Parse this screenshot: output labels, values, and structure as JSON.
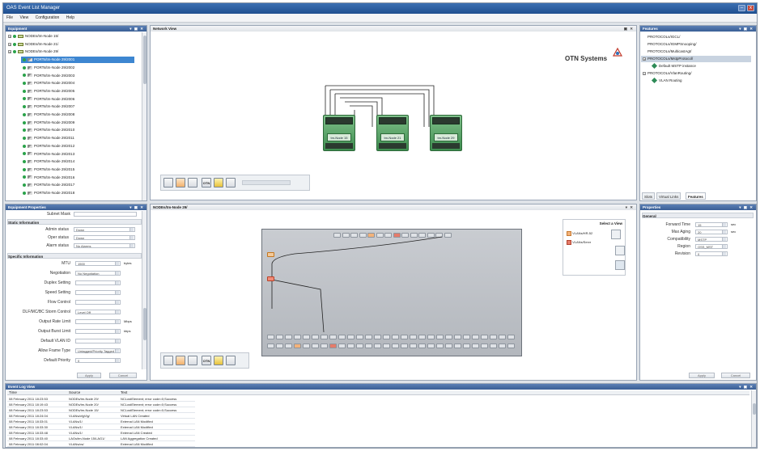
{
  "window": {
    "title": "OAS Event List Manager",
    "minimize_glyph": "–",
    "restore_glyph": "❐",
    "close_glyph": "x"
  },
  "menu": [
    "File",
    "View",
    "Configuration",
    "Help"
  ],
  "equipment": {
    "title": "Equipment",
    "controls": "▾ ▣ ✕",
    "nodes": [
      {
        "label": "NODEs/tm-Node 15/",
        "kind": "node",
        "indent": 0
      },
      {
        "label": "NODEs/tm-Node 21/",
        "kind": "node",
        "indent": 0
      },
      {
        "label": "NODEs/tm-Node 29/",
        "kind": "node",
        "indent": 0
      },
      {
        "label": "PORTs/tm-Node 29/2001",
        "kind": "port",
        "indent": 1,
        "selected": true
      },
      {
        "label": "PORTs/tm-Node 29/2002",
        "kind": "port",
        "indent": 1
      },
      {
        "label": "PORTs/tm-Node 29/2003",
        "kind": "port",
        "indent": 1
      },
      {
        "label": "PORTs/tm-Node 29/2004",
        "kind": "port",
        "indent": 1
      },
      {
        "label": "PORTs/tm-Node 29/2005",
        "kind": "port",
        "indent": 1
      },
      {
        "label": "PORTs/tm-Node 29/2006",
        "kind": "port",
        "indent": 1
      },
      {
        "label": "PORTs/tm-Node 29/2007",
        "kind": "port",
        "indent": 1
      },
      {
        "label": "PORTs/tm-Node 29/2008",
        "kind": "port",
        "indent": 1
      },
      {
        "label": "PORTs/tm-Node 29/2009",
        "kind": "port",
        "indent": 1
      },
      {
        "label": "PORTs/tm-Node 29/2010",
        "kind": "port",
        "indent": 1
      },
      {
        "label": "PORTs/tm-Node 29/2011",
        "kind": "port",
        "indent": 1
      },
      {
        "label": "PORTs/tm-Node 29/2012",
        "kind": "port",
        "indent": 1
      },
      {
        "label": "PORTs/tm-Node 29/2013",
        "kind": "port",
        "indent": 1
      },
      {
        "label": "PORTs/tm-Node 29/2014",
        "kind": "port",
        "indent": 1
      },
      {
        "label": "PORTs/tm-Node 29/2015",
        "kind": "port",
        "indent": 1
      },
      {
        "label": "PORTs/tm-Node 29/2016",
        "kind": "port",
        "indent": 1
      },
      {
        "label": "PORTs/tm-Node 29/2017",
        "kind": "port",
        "indent": 1
      },
      {
        "label": "PORTs/tm-Node 29/2018",
        "kind": "port",
        "indent": 1
      }
    ]
  },
  "network_view": {
    "title": "Network View",
    "controls": "▣ ✕",
    "logo_text": "OTN Systems",
    "devices": [
      "tm-Node 15",
      "tm-Node 21",
      "tm-Node 29"
    ],
    "toolbar_icons": [
      "print-icon",
      "export-icon",
      "image-icon",
      "otn-icon",
      "lock-icon",
      "zoom-icon"
    ],
    "toolbar_otn_label": "OTN"
  },
  "node_view": {
    "title": "NODEs/tm-Node 29/",
    "controls": "▾ ✕",
    "select_title": "Select a View",
    "views": [
      "VLANs/HR-52",
      "VLANs/Servr"
    ],
    "toolbar_otn_label": "OTN"
  },
  "features": {
    "title": "Features",
    "controls": "▾ ▣ ✕",
    "items": [
      {
        "label": "PROTOCOLs/IGCL/",
        "indent": 1
      },
      {
        "label": "PROTOCOLs/IGMPSnooping/",
        "indent": 1
      },
      {
        "label": "PROTOCOLs/MulticastAgt/",
        "indent": 1
      },
      {
        "label": "PROTOCOLs/MstpProtocol/",
        "indent": 0,
        "selected": true,
        "expander": "+"
      },
      {
        "label": "Default MSTP instance",
        "indent": 2,
        "icon": true
      },
      {
        "label": "PROTOCOLs/VlanRouting/",
        "indent": 0,
        "expander": "−"
      },
      {
        "label": "VLAN Routing",
        "indent": 2,
        "icon": true
      }
    ],
    "tabs": [
      "Slots",
      "Virtual Links",
      "Features"
    ],
    "active_tab": "Features"
  },
  "eq_props": {
    "title": "Equipment Properties",
    "controls": "▾ ▣ ✕",
    "subnet_label": "Subnet Mask",
    "status_section": "Static Information",
    "status_rows": [
      {
        "label": "Admin status",
        "value": "Down"
      },
      {
        "label": "Oper status",
        "value": "Down"
      },
      {
        "label": "Alarm status",
        "value": "No Alarms"
      }
    ],
    "specific_section": "Specific Information",
    "specific_rows": [
      {
        "label": "MTU",
        "value": "1500",
        "unit": "bytes"
      },
      {
        "label": "Negotiation",
        "value": "No Negotiation"
      },
      {
        "label": "Duplex Setting",
        "value": ""
      },
      {
        "label": "Speed Setting",
        "value": ""
      },
      {
        "label": "Flow Control",
        "value": ""
      },
      {
        "label": "DLF/MC/BC Storm Control",
        "value": "Level Off"
      },
      {
        "label": "Output Rate Limit",
        "value": "",
        "unit": "Mbps"
      },
      {
        "label": "Output Burst Limit",
        "value": "",
        "unit": "kbps"
      },
      {
        "label": "Default VLAN ID",
        "value": ""
      },
      {
        "label": "Allow Frame Type",
        "value": "Untagged/Priority Tagged"
      },
      {
        "label": "Default Priority",
        "value": "0"
      }
    ],
    "apply_label": "Apply",
    "cancel_label": "Cancel"
  },
  "properties": {
    "title": "Properties",
    "controls": "▾ ▣ ✕",
    "section": "General",
    "rows": [
      {
        "label": "Forward Time",
        "value": "15",
        "unit": "sec"
      },
      {
        "label": "Max Aging",
        "value": "20",
        "unit": "sec"
      },
      {
        "label": "Compatibility",
        "value": "MSTP"
      },
      {
        "label": "Region",
        "value": "OSS_MST"
      },
      {
        "label": "Revision",
        "value": "0"
      }
    ],
    "apply_label": "Apply",
    "cancel_label": "Cancel"
  },
  "event_log": {
    "title": "Event Log View",
    "controls": "▾ ▣ ✕",
    "columns": [
      "Time",
      "Source",
      "Text"
    ],
    "rows": [
      {
        "time": "08 February 2011 18:23:53",
        "source": "NODEs/tm-Node 29/",
        "text": "NCLostElement; error code=0;Success"
      },
      {
        "time": "08 February 2011 18:19:43",
        "source": "NODEs/tm-Node 20/",
        "text": "NCLostElement; error code=0;Success"
      },
      {
        "time": "08 February 2011 18:23:53",
        "source": "NODEs/tm-Node 15/",
        "text": "NCLostElement; error code=0;Success"
      },
      {
        "time": "08 February 2011 18:24:04",
        "source": "VLANs/cfgVlg/",
        "text": "Virtual LAN Created"
      },
      {
        "time": "08 February 2011 18:33:01",
        "source": "VLANs/1/",
        "text": "External LAN Modified"
      },
      {
        "time": "08 February 2011 18:33:30",
        "source": "VLANs/1/",
        "text": "External LAN Modified"
      },
      {
        "time": "08 February 2011 18:33:48",
        "source": "VLANs/1/",
        "text": "External LAN Created"
      },
      {
        "time": "08 February 2011 18:33:40",
        "source": "LAGs/tm-Node 15/LAG1/",
        "text": "LAN Aggregation Created"
      },
      {
        "time": "08 February 2011 08:02:04",
        "source": "VLANs/cs/",
        "text": "External LAN Modified"
      }
    ]
  }
}
